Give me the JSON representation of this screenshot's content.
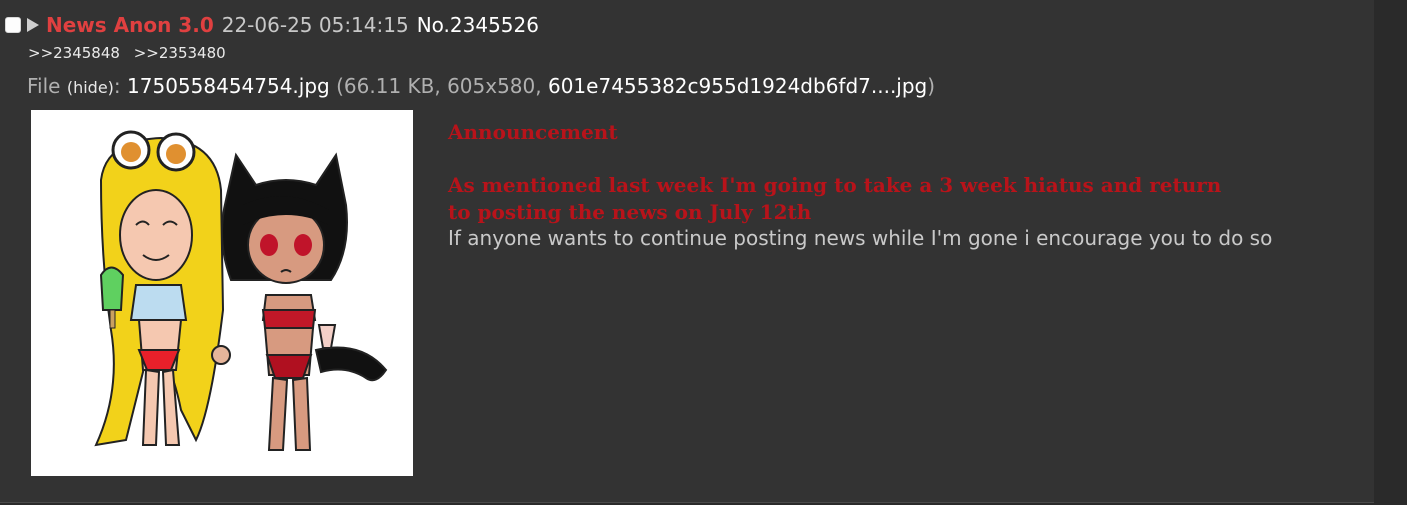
{
  "post": {
    "name": "News Anon 3.0",
    "date": "22-06-25 05:14:15",
    "number": "No.2345526",
    "backlinks": [
      ">>2345848",
      ">>2353480"
    ]
  },
  "file": {
    "prefix": "File",
    "hide_label": "(hide)",
    "filename": "1750558454754.jpg",
    "size_and_dims": "(66.11 KB, 605x580,",
    "original_name": "601e7455382c955d1924db6fd7....jpg",
    "close_paren": ")"
  },
  "body": {
    "title": "Announcement",
    "main": "As mentioned last week I'm going to take a 3 week hiatus and return to posting the news on July 12th",
    "sub": "If anyone wants to continue posting news while I'm gone i encourage you to do so"
  },
  "colors": {
    "background": "#333333",
    "name_red": "#e04040",
    "announcement_red": "#b8131a"
  },
  "icons": [
    "checkbox",
    "expand-arrow-icon"
  ]
}
